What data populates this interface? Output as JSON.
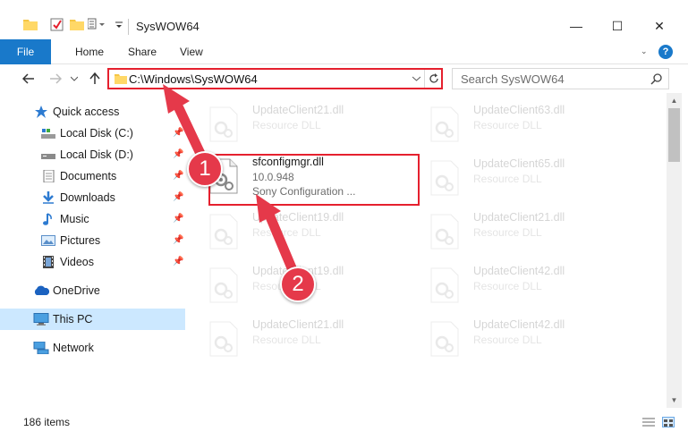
{
  "window": {
    "title": "SysWOW64",
    "minimize": "—",
    "maximize": "☐",
    "close": "✕"
  },
  "ribbon": {
    "tabs": [
      "File",
      "Home",
      "Share",
      "View"
    ],
    "help": "?"
  },
  "address_bar": {
    "path": "C:\\Windows\\SysWOW64",
    "search_placeholder": "Search SysWOW64"
  },
  "sidebar": {
    "items": [
      {
        "label": "Quick access",
        "icon": "star-icon",
        "pinned": false
      },
      {
        "label": "Local Disk (C:)",
        "icon": "drive-icon",
        "pinned": true
      },
      {
        "label": "Local Disk (D:)",
        "icon": "drive-icon",
        "pinned": true
      },
      {
        "label": "Documents",
        "icon": "documents-icon",
        "pinned": true
      },
      {
        "label": "Downloads",
        "icon": "download-icon",
        "pinned": true
      },
      {
        "label": "Music",
        "icon": "music-icon",
        "pinned": true
      },
      {
        "label": "Pictures",
        "icon": "pictures-icon",
        "pinned": true
      },
      {
        "label": "Videos",
        "icon": "videos-icon",
        "pinned": true
      },
      {
        "label": "OneDrive",
        "icon": "cloud-icon",
        "pinned": false
      },
      {
        "label": "This PC",
        "icon": "computer-icon",
        "pinned": false,
        "selected": true
      },
      {
        "label": "Network",
        "icon": "network-icon",
        "pinned": false
      }
    ]
  },
  "files": [
    {
      "name": "UpdateClient21.dll",
      "line2": "Resource DLL",
      "line3": "",
      "faded": true
    },
    {
      "name": "UpdateClient63.dll",
      "line2": "Resource DLL",
      "line3": "",
      "faded": true
    },
    {
      "name": "sfconfigmgr.dll",
      "line2": "10.0.948",
      "line3": "Sony Configuration ...",
      "faded": false
    },
    {
      "name": "UpdateClient65.dll",
      "line2": "Resource DLL",
      "line3": "",
      "faded": true
    },
    {
      "name": "UpdateClient19.dll",
      "line2": "Resource DLL",
      "line3": "",
      "faded": true
    },
    {
      "name": "UpdateClient21.dll",
      "line2": "Resource DLL",
      "line3": "",
      "faded": true
    },
    {
      "name": "UpdateClient19.dll",
      "line2": "Resource DLL",
      "line3": "",
      "faded": true
    },
    {
      "name": "UpdateClient42.dll",
      "line2": "Resource DLL",
      "line3": "",
      "faded": true
    },
    {
      "name": "UpdateClient21.dll",
      "line2": "Resource DLL",
      "line3": "",
      "faded": true
    },
    {
      "name": "UpdateClient42.dll",
      "line2": "Resource DLL",
      "line3": "",
      "faded": true
    }
  ],
  "status": {
    "item_count": "186 items"
  },
  "annotations": {
    "badge1": "1",
    "badge2": "2"
  },
  "colors": {
    "accent": "#1979ca",
    "highlight": "#e5202e",
    "badge": "#e5394a",
    "selected": "#cce8ff"
  }
}
